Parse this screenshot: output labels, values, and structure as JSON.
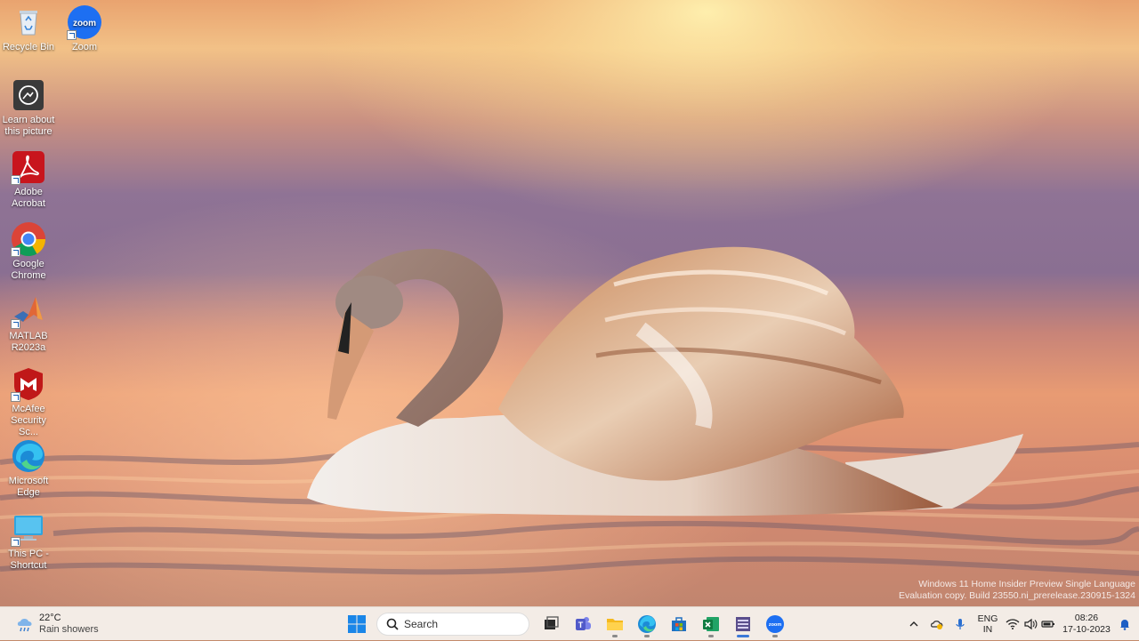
{
  "desktop": {
    "icons": [
      {
        "label": "Recycle Bin",
        "icon": "recycle-bin-icon"
      },
      {
        "label": "Zoom",
        "icon": "zoom-icon"
      },
      {
        "label": "Learn about this picture",
        "icon": "learn-picture-icon"
      },
      {
        "label": "Adobe Acrobat",
        "icon": "adobe-acrobat-icon"
      },
      {
        "label": "Google Chrome",
        "icon": "chrome-icon"
      },
      {
        "label": "MATLAB R2023a",
        "icon": "matlab-icon"
      },
      {
        "label": "McAfee Security Sc...",
        "icon": "mcafee-icon"
      },
      {
        "label": "Microsoft Edge",
        "icon": "edge-icon"
      },
      {
        "label": "This PC - Shortcut",
        "icon": "this-pc-icon"
      }
    ],
    "watermark": {
      "line1": "Windows 11 Home Insider Preview Single Language",
      "line2": "Evaluation copy. Build 23550.ni_prerelease.230915-1324"
    }
  },
  "taskbar": {
    "weather": {
      "temp": "22°C",
      "condition": "Rain showers"
    },
    "search_placeholder": "Search",
    "apps": [
      "start-icon",
      "task-view-icon",
      "teams-icon",
      "file-explorer-icon",
      "edge-icon",
      "store-icon",
      "excel-icon",
      "presentation-app-icon",
      "zoom-icon"
    ],
    "tray": {
      "lang_line1": "ENG",
      "lang_line2": "IN",
      "time": "08:26",
      "date": "17-10-2023"
    }
  },
  "colors": {
    "taskbar_bg": "#f3ece6",
    "accent": "#3b78d8"
  }
}
